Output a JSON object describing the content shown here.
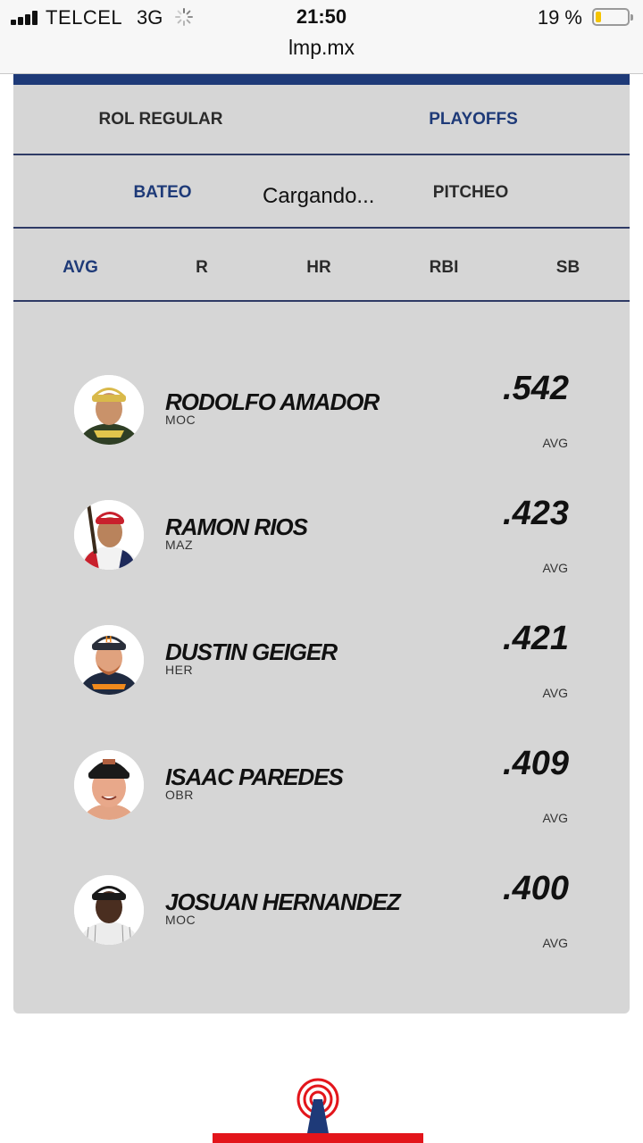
{
  "status_bar": {
    "carrier": "TELCEL",
    "network": "3G",
    "time": "21:50",
    "battery_percent": "19 %",
    "battery_level": 0.19,
    "url": "lmp.mx"
  },
  "season_tabs": [
    {
      "label": "ROL REGULAR",
      "active": false
    },
    {
      "label": "PLAYOFFS",
      "active": true
    }
  ],
  "type_tabs": [
    {
      "label": "BATEO",
      "active": true
    },
    {
      "label": "PITCHEO",
      "active": false
    }
  ],
  "loading_text": "Cargando...",
  "stat_tabs": [
    {
      "label": "AVG",
      "active": true
    },
    {
      "label": "R",
      "active": false
    },
    {
      "label": "HR",
      "active": false
    },
    {
      "label": "RBI",
      "active": false
    },
    {
      "label": "SB",
      "active": false
    }
  ],
  "leaders": [
    {
      "name": "RODOLFO AMADOR",
      "team": "MOC",
      "value": ".542",
      "stat": "AVG"
    },
    {
      "name": "RAMON RIOS",
      "team": "MAZ",
      "value": ".423",
      "stat": "AVG"
    },
    {
      "name": "DUSTIN GEIGER",
      "team": "HER",
      "value": ".421",
      "stat": "AVG"
    },
    {
      "name": "ISAAC PAREDES",
      "team": "OBR",
      "value": ".409",
      "stat": "AVG"
    },
    {
      "name": "JOSUAN HERNANDEZ",
      "team": "MOC",
      "value": ".400",
      "stat": "AVG"
    }
  ],
  "colors": {
    "accent": "#1e3a78",
    "panel": "#d6d6d6",
    "battery": "#f5c400",
    "logo_red": "#e3151b"
  }
}
